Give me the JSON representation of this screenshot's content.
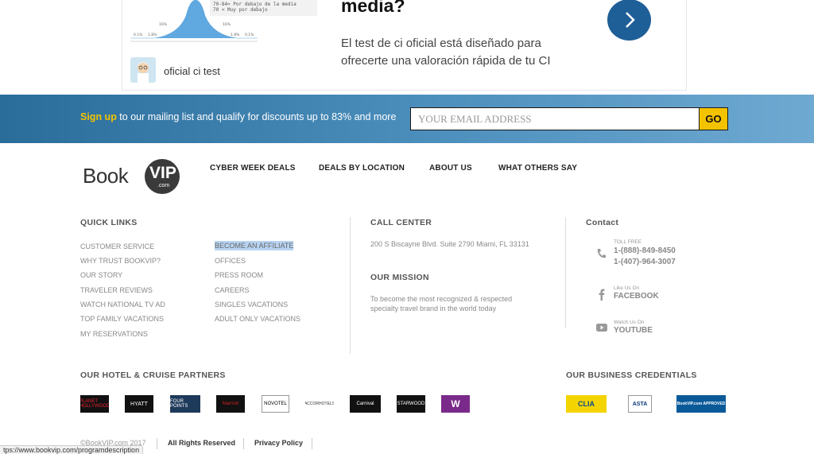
{
  "ad": {
    "chart_code_lines": [
      "70-84= Por debajo de la media",
      "70 < Muy por debajo"
    ],
    "chart_percent_labels": [
      "0.1%",
      "1.8%",
      "16%",
      "16%",
      "1.8%",
      "0.1%"
    ],
    "source": "oficial ci test",
    "headline": "media?",
    "body": "El test de ci oficial está diseñado para ofrecerte una valoración rápida de tu CI"
  },
  "banner": {
    "highlight": "Sign up",
    "text": " to our mailing list and qualify for discounts up to 83% and more",
    "email_placeholder": "YOUR EMAIL ADDRESS",
    "go_label": "GO"
  },
  "logo": {
    "book": "Book",
    "vip": "VIP",
    "com": ".com"
  },
  "nav": [
    "CYBER WEEK DEALS",
    "DEALS BY LOCATION",
    "ABOUT US",
    "WHAT OTHERS SAY"
  ],
  "quick_links": {
    "heading": "QUICK LINKS",
    "col1": [
      "CUSTOMER SERVICE",
      "WHY TRUST BOOKVIP?",
      "OUR STORY",
      "TRAVELER REVIEWS",
      "WATCH NATIONAL TV AD",
      "TOP FAMILY VACATIONS",
      "MY RESERVATIONS"
    ],
    "col2": [
      "BECOME AN AFFILIATE",
      "OFFICES",
      "PRESS ROOM",
      "CAREERS",
      "SINGLES VACATIONS",
      "ADULT ONLY VACATIONS"
    ]
  },
  "call_center": {
    "heading": "CALL CENTER",
    "address": "200 S Biscayne Blvd. Suite 2790 Miami, FL 33131",
    "mission_heading": "OUR MISSION",
    "mission_text": "To become the most recognized & respected specialty travel brand in the world today"
  },
  "contact": {
    "heading": "Contact",
    "phone_label": "TOLL FREE",
    "phone1": "1-(888)-849-8450",
    "phone2": "1-(407)-964-3007",
    "facebook_label": "Like Us On",
    "facebook": "FACEBOOK",
    "youtube_label": "Watch Us On",
    "youtube": "YOUTUBE"
  },
  "partners_heading": "OUR HOTEL & CRUISE PARTNERS",
  "partners": [
    "PLANET HOLLYWOOD",
    "HYATT",
    "FOUR POINTS",
    "Marriott",
    "NOVOTEL",
    "ACCORHOTELS",
    "Carnival",
    "STARWOOD",
    "W"
  ],
  "credentials_heading": "OUR BUSINESS CREDENTIALS",
  "credentials": [
    "CLIA",
    "ASTA",
    "BookVIP.com APPROVED"
  ],
  "footer": {
    "copyright": "©BookVIP.com 2017",
    "rights": "All Rights Reserved",
    "privacy": "Privacy Policy",
    "status_url": "tps://www.bookvip.com/programdescription"
  },
  "colors": {
    "banner_accent": "#f4c300",
    "arrow_button": "#1f5f98",
    "link_highlight": "#b8d4f2"
  }
}
